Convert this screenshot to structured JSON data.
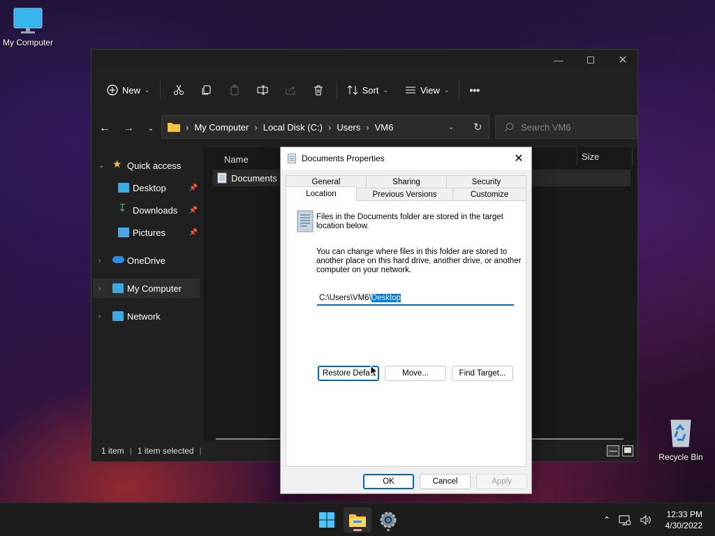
{
  "desktop": {
    "icons": [
      {
        "label": "My Computer"
      },
      {
        "label": "Recycle Bin"
      }
    ]
  },
  "explorer": {
    "toolbar": {
      "new_label": "New",
      "sort_label": "Sort",
      "view_label": "View",
      "more_label": "•••"
    },
    "breadcrumb": [
      "My Computer",
      "Local Disk (C:)",
      "Users",
      "VM6"
    ],
    "search_placeholder": "Search VM6",
    "sidebar": {
      "items": [
        {
          "label": "Quick access"
        },
        {
          "label": "Desktop"
        },
        {
          "label": "Downloads"
        },
        {
          "label": "Pictures"
        },
        {
          "label": "OneDrive"
        },
        {
          "label": "My Computer"
        },
        {
          "label": "Network"
        }
      ]
    },
    "columns": {
      "name": "Name",
      "size": "Size"
    },
    "files": [
      {
        "name": "Documents"
      }
    ],
    "status": {
      "count": "1 item",
      "selected": "1 item selected"
    }
  },
  "dialog": {
    "title": "Documents Properties",
    "tabs_top": [
      "General",
      "Sharing",
      "Security"
    ],
    "tabs_bottom": [
      "Location",
      "Previous Versions",
      "Customize"
    ],
    "info_text": "Files in the Documents folder are stored in the target location below.",
    "info_line1": "Files in the Documents folder are stored in the target",
    "info_line2": "location below.",
    "desc_line1": "You can change where files in this folder are stored to",
    "desc_line2": "another place on this hard drive, another drive, or another",
    "desc_line3": "computer on your network.",
    "path_prefix": "C:\\Users\\VM6\\",
    "path_selected": "Desktop",
    "buttons": {
      "restore": "Restore Defau",
      "move": "Move...",
      "find_target": "Find Target...",
      "ok": "OK",
      "cancel": "Cancel",
      "apply": "Apply"
    }
  },
  "taskbar": {
    "time": "12:33 PM",
    "date": "4/30/2022"
  },
  "colors": {
    "accent": "#0078d7",
    "explorer_bg": "#202020",
    "dialog_bg": "#f0f0f0"
  }
}
